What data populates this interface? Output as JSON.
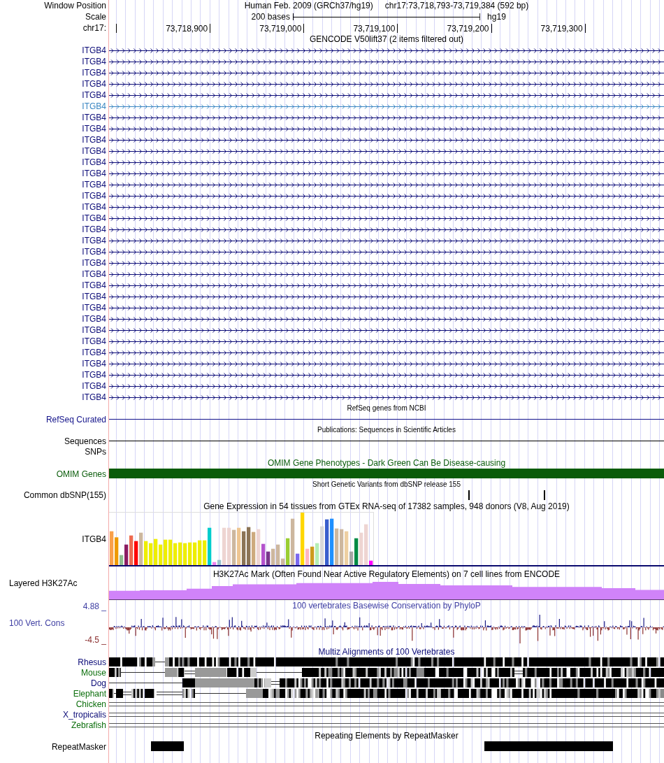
{
  "header": {
    "window_label": "Window Position",
    "assembly": "Human Feb. 2009 (GRCh37/hg19)",
    "position": "chr17:73,718,793-73,719,384 (592 bp)",
    "scale_label": "Scale",
    "scale_length": "200 bases",
    "scale_db": "hg19",
    "ruler_label": "chr17:",
    "tick_labels": [
      "73,718,900",
      "73,719,000",
      "73,719,100",
      "73,719,200",
      "73,719,300"
    ]
  },
  "tracks": [
    {
      "kind": "genes",
      "title": "GENCODE V50lift37 (2 items filtered out)",
      "items": [
        {
          "name": "ITGB4",
          "selected": false
        },
        {
          "name": "ITGB4",
          "selected": false
        },
        {
          "name": "ITGB4",
          "selected": false
        },
        {
          "name": "ITGB4",
          "selected": false
        },
        {
          "name": "ITGB4",
          "selected": false
        },
        {
          "name": "ITGB4",
          "selected": true
        },
        {
          "name": "ITGB4",
          "selected": false
        },
        {
          "name": "ITGB4",
          "selected": false
        },
        {
          "name": "ITGB4",
          "selected": false
        },
        {
          "name": "ITGB4",
          "selected": false
        },
        {
          "name": "ITGB4",
          "selected": false
        },
        {
          "name": "ITGB4",
          "selected": false
        },
        {
          "name": "ITGB4",
          "selected": false
        },
        {
          "name": "ITGB4",
          "selected": false
        },
        {
          "name": "ITGB4",
          "selected": false
        },
        {
          "name": "ITGB4",
          "selected": false
        },
        {
          "name": "ITGB4",
          "selected": false
        },
        {
          "name": "ITGB4",
          "selected": false
        },
        {
          "name": "ITGB4",
          "selected": false
        },
        {
          "name": "ITGB4",
          "selected": false
        },
        {
          "name": "ITGB4",
          "selected": false
        },
        {
          "name": "ITGB4",
          "selected": false
        },
        {
          "name": "ITGB4",
          "selected": false
        },
        {
          "name": "ITGB4",
          "selected": false
        },
        {
          "name": "ITGB4",
          "selected": false
        },
        {
          "name": "ITGB4",
          "selected": false
        },
        {
          "name": "ITGB4",
          "selected": false
        },
        {
          "name": "ITGB4",
          "selected": false
        },
        {
          "name": "ITGB4",
          "selected": false
        },
        {
          "name": "ITGB4",
          "selected": false
        },
        {
          "name": "ITGB4",
          "selected": false
        },
        {
          "name": "ITGB4",
          "selected": false
        }
      ]
    },
    {
      "kind": "line",
      "title": "RefSeq genes from NCBI",
      "label": "RefSeq Curated",
      "color": "#12128a"
    },
    {
      "kind": "line",
      "title": "Publications: Sequences in Scientific Articles",
      "label": "Sequences",
      "color": "#000000"
    },
    {
      "kind": "label",
      "label": "SNPs",
      "color": "#000000"
    },
    {
      "kind": "bar",
      "title": "OMIM Gene Phenotypes - Dark Green Can Be Disease-causing",
      "label": "OMIM Genes",
      "color": "#0a5c0a"
    },
    {
      "kind": "ticks",
      "title": "Short Genetic Variants from dbSNP release 155",
      "label": "Common dbSNP(155)",
      "color": "#000000"
    },
    {
      "kind": "expression",
      "title": "Gene Expression in 54 tissues from GTEx RNA-seq of 17382 samples, 948 donors (V8, Aug 2019)",
      "label": "ITGB4",
      "color": "#000000"
    },
    {
      "kind": "signal",
      "title": "H3K27Ac Mark (Often Found Near Active Regulatory Elements) on 7 cell lines from ENCODE",
      "label": "Layered H3K27Ac",
      "color": "#000000"
    },
    {
      "kind": "wiggle",
      "title": "100 vertebrates Basewise Conservation by PhyloP",
      "label": "100 Vert. Cons",
      "top_tick": "4.88 _",
      "bottom_tick": "-4.5 _",
      "color": "#3f3fa3"
    },
    {
      "kind": "alignment",
      "title": "Multiz Alignments of 100 Vertebrates",
      "color": "#0c0c78",
      "species": [
        {
          "name": "Rhesus",
          "color": "#0c0c78",
          "kind": "aligned"
        },
        {
          "name": "Mouse",
          "color": "#0b6e0b",
          "kind": "aligned"
        },
        {
          "name": "Dog",
          "color": "#0c0c78",
          "kind": "aligned"
        },
        {
          "name": "Elephant",
          "color": "#0b6e0b",
          "kind": "aligned"
        },
        {
          "name": "Chicken",
          "color": "#0b6e0b",
          "kind": "unaligned"
        },
        {
          "name": "X_tropicalis",
          "color": "#0c0c78",
          "kind": "unaligned"
        },
        {
          "name": "Zebrafish",
          "color": "#0b6e0b",
          "kind": "unaligned"
        }
      ]
    },
    {
      "kind": "blocks",
      "title": "Repeating Elements by RepeatMasker",
      "label": "RepeatMasker",
      "color": "#000000"
    }
  ]
}
